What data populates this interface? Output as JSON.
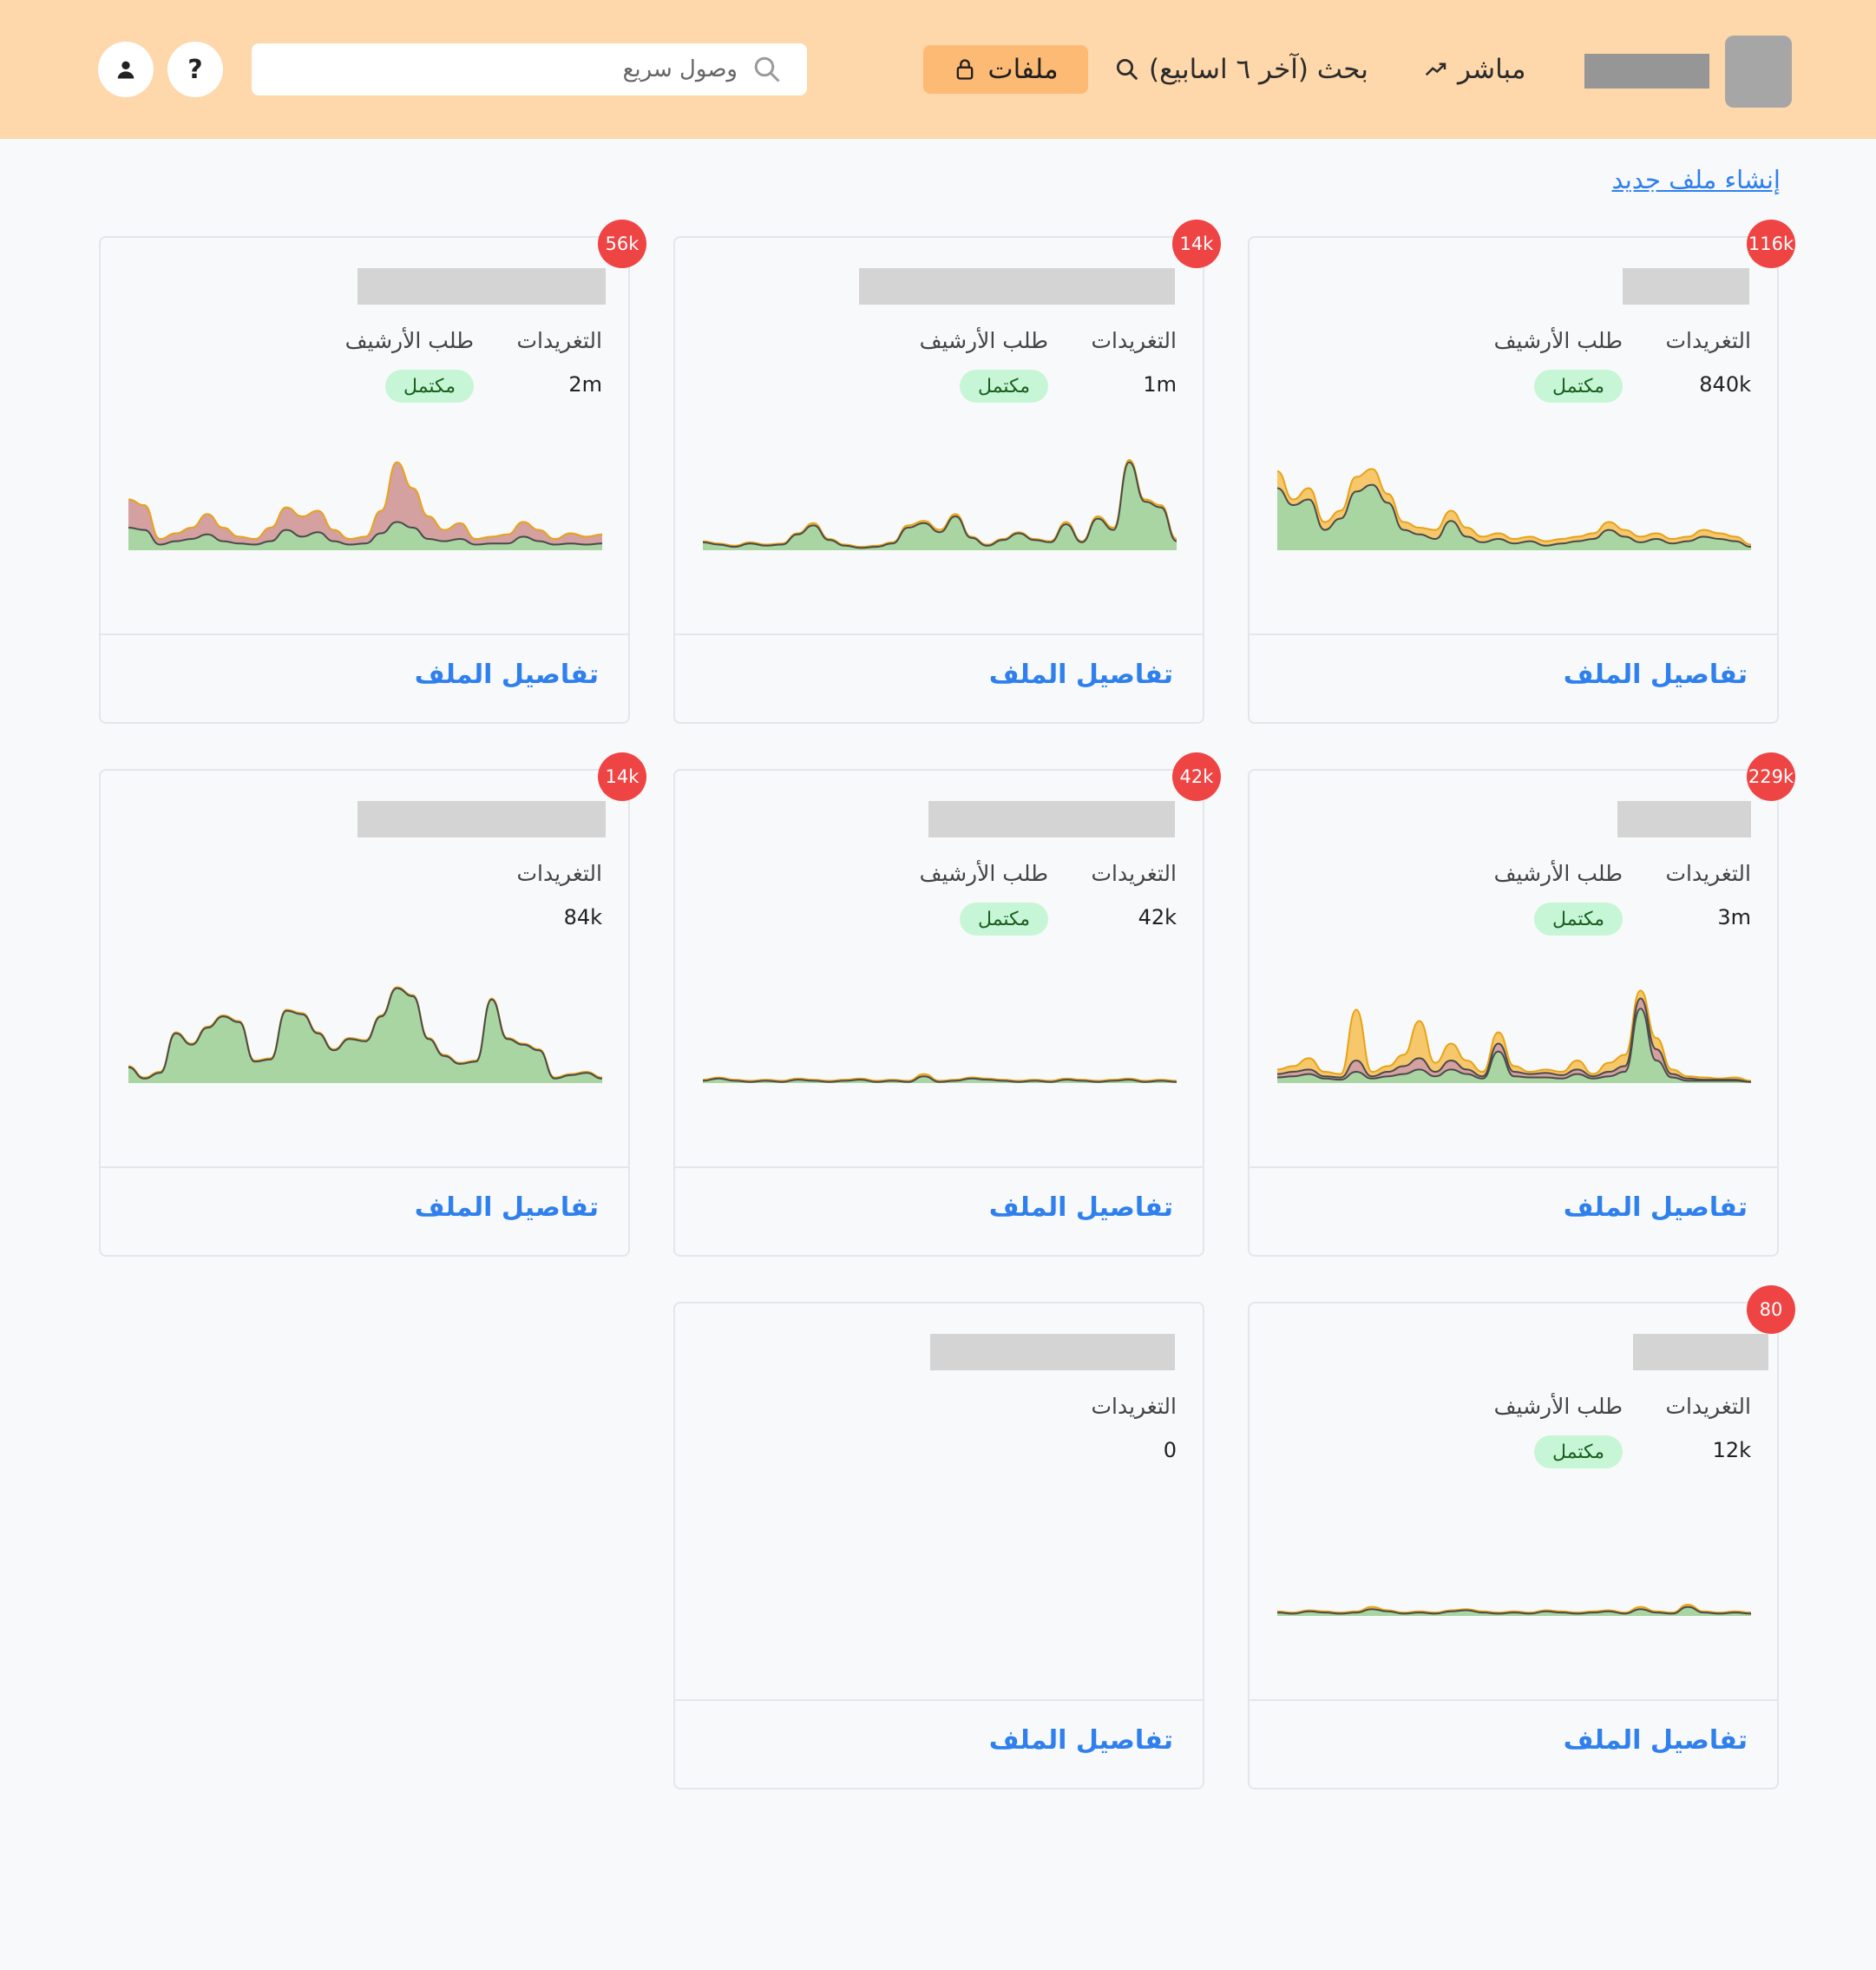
{
  "header": {
    "nav": {
      "live_label": "مباشر",
      "search_label": "بحث (آخر ٦ اسابيع)",
      "files_label": "ملفات"
    },
    "quick_access": {
      "placeholder": "وصول سريع",
      "value": ""
    },
    "help_label": "?",
    "icons": [
      "trend-up-icon",
      "search-icon",
      "lock-icon",
      "user-icon"
    ]
  },
  "main": {
    "create_link": "إنشاء ملف جديد",
    "labels": {
      "tweets": "التغريدات",
      "archive": "طلب الأرشيف",
      "complete": "مكتمل",
      "details": "تفاصيل الملف"
    },
    "colors": {
      "area_green": "#a8d5a2",
      "area_red": "#d4a0a0",
      "area_yellow": "#f6c76b",
      "badge": "#ef4444",
      "link": "#2f80ed"
    },
    "cards": [
      {
        "badge": "116k",
        "tweets": "840k",
        "archive_status": "مكتمل",
        "chart_data": {
          "type": "area",
          "series": [
            {
              "color": "#f6c76b",
              "values": [
                0.7,
                0.45,
                0.55,
                0.25,
                0.35,
                0.65,
                0.72,
                0.5,
                0.25,
                0.2,
                0.18,
                0.35,
                0.2,
                0.12,
                0.15,
                0.1,
                0.12,
                0.08,
                0.1,
                0.12,
                0.15,
                0.25,
                0.18,
                0.12,
                0.15,
                0.1,
                0.12,
                0.18,
                0.15,
                0.12,
                0.05
              ]
            },
            {
              "color": "#a8d5a2",
              "values": [
                0.55,
                0.4,
                0.45,
                0.18,
                0.28,
                0.52,
                0.58,
                0.42,
                0.18,
                0.14,
                0.1,
                0.26,
                0.12,
                0.07,
                0.1,
                0.06,
                0.08,
                0.04,
                0.06,
                0.08,
                0.1,
                0.18,
                0.12,
                0.07,
                0.1,
                0.06,
                0.08,
                0.12,
                0.1,
                0.08,
                0.03
              ]
            }
          ]
        }
      },
      {
        "badge": "14k",
        "tweets": "1m",
        "archive_status": "مكتمل",
        "chart_data": {
          "type": "area",
          "series": [
            {
              "color": "#f6c76b",
              "values": [
                0.08,
                0.06,
                0.04,
                0.07,
                0.05,
                0.06,
                0.15,
                0.24,
                0.1,
                0.05,
                0.03,
                0.04,
                0.07,
                0.22,
                0.26,
                0.18,
                0.32,
                0.12,
                0.05,
                0.1,
                0.16,
                0.1,
                0.08,
                0.25,
                0.08,
                0.3,
                0.2,
                0.8,
                0.45,
                0.4,
                0.1
              ]
            },
            {
              "color": "#a8d5a2",
              "values": [
                0.07,
                0.05,
                0.03,
                0.06,
                0.04,
                0.05,
                0.14,
                0.22,
                0.09,
                0.04,
                0.02,
                0.03,
                0.06,
                0.2,
                0.24,
                0.16,
                0.3,
                0.11,
                0.04,
                0.09,
                0.15,
                0.09,
                0.07,
                0.23,
                0.07,
                0.28,
                0.18,
                0.78,
                0.43,
                0.38,
                0.08
              ]
            }
          ]
        }
      },
      {
        "badge": "56k",
        "tweets": "2m",
        "archive_status": "مكتمل",
        "chart_data": {
          "type": "area",
          "series": [
            {
              "color": "#d4a0a0",
              "values": [
                0.45,
                0.4,
                0.1,
                0.15,
                0.2,
                0.32,
                0.2,
                0.12,
                0.1,
                0.2,
                0.38,
                0.3,
                0.35,
                0.18,
                0.1,
                0.12,
                0.35,
                0.78,
                0.55,
                0.3,
                0.18,
                0.24,
                0.1,
                0.12,
                0.14,
                0.25,
                0.18,
                0.1,
                0.15,
                0.12,
                0.14
              ]
            },
            {
              "color": "#a8d5a2",
              "values": [
                0.2,
                0.18,
                0.05,
                0.08,
                0.1,
                0.14,
                0.08,
                0.06,
                0.05,
                0.08,
                0.18,
                0.12,
                0.16,
                0.08,
                0.05,
                0.06,
                0.15,
                0.25,
                0.2,
                0.1,
                0.08,
                0.1,
                0.05,
                0.06,
                0.06,
                0.12,
                0.08,
                0.05,
                0.06,
                0.05,
                0.06
              ]
            }
          ]
        }
      },
      {
        "badge": "229k",
        "tweets": "3m",
        "archive_status": "مكتمل",
        "chart_data": {
          "type": "area",
          "series": [
            {
              "color": "#f6c76b",
              "values": [
                0.12,
                0.15,
                0.22,
                0.1,
                0.08,
                0.65,
                0.1,
                0.15,
                0.25,
                0.55,
                0.18,
                0.35,
                0.2,
                0.1,
                0.45,
                0.15,
                0.1,
                0.12,
                0.1,
                0.2,
                0.08,
                0.18,
                0.25,
                0.82,
                0.4,
                0.12,
                0.06,
                0.05,
                0.04,
                0.05,
                0.02
              ]
            },
            {
              "color": "#d4a0a0",
              "values": [
                0.08,
                0.1,
                0.12,
                0.06,
                0.05,
                0.2,
                0.06,
                0.1,
                0.15,
                0.22,
                0.1,
                0.2,
                0.12,
                0.06,
                0.35,
                0.1,
                0.08,
                0.09,
                0.07,
                0.12,
                0.06,
                0.1,
                0.15,
                0.75,
                0.3,
                0.08,
                0.04,
                0.03,
                0.03,
                0.03,
                0.01
              ]
            },
            {
              "color": "#a8d5a2",
              "values": [
                0.05,
                0.06,
                0.08,
                0.04,
                0.03,
                0.1,
                0.04,
                0.06,
                0.08,
                0.12,
                0.06,
                0.12,
                0.08,
                0.04,
                0.28,
                0.06,
                0.05,
                0.05,
                0.04,
                0.08,
                0.04,
                0.06,
                0.1,
                0.66,
                0.2,
                0.05,
                0.02,
                0.02,
                0.02,
                0.02,
                0.01
              ]
            }
          ]
        }
      },
      {
        "badge": "42k",
        "tweets": "42k",
        "archive_status": "مكتمل",
        "chart_data": {
          "type": "area",
          "series": [
            {
              "color": "#f6c76b",
              "values": [
                0.03,
                0.05,
                0.03,
                0.02,
                0.03,
                0.02,
                0.04,
                0.03,
                0.02,
                0.03,
                0.04,
                0.02,
                0.03,
                0.02,
                0.08,
                0.02,
                0.03,
                0.05,
                0.04,
                0.03,
                0.02,
                0.03,
                0.02,
                0.04,
                0.03,
                0.02,
                0.03,
                0.04,
                0.02,
                0.03,
                0.02
              ]
            },
            {
              "color": "#a8d5a2",
              "values": [
                0.02,
                0.04,
                0.02,
                0.01,
                0.02,
                0.01,
                0.03,
                0.02,
                0.01,
                0.02,
                0.03,
                0.01,
                0.02,
                0.01,
                0.06,
                0.01,
                0.02,
                0.04,
                0.03,
                0.02,
                0.01,
                0.02,
                0.01,
                0.03,
                0.02,
                0.01,
                0.02,
                0.03,
                0.01,
                0.02,
                0.01
              ]
            }
          ]
        }
      },
      {
        "badge": "14k",
        "tweets": "84k",
        "chart_data": {
          "type": "area",
          "series": [
            {
              "color": "#f6c76b",
              "values": [
                0.15,
                0.05,
                0.1,
                0.45,
                0.35,
                0.5,
                0.6,
                0.55,
                0.2,
                0.22,
                0.65,
                0.62,
                0.45,
                0.3,
                0.4,
                0.38,
                0.6,
                0.85,
                0.78,
                0.4,
                0.25,
                0.18,
                0.2,
                0.75,
                0.4,
                0.35,
                0.3,
                0.05,
                0.08,
                0.1,
                0.05
              ]
            },
            {
              "color": "#a8d5a2",
              "values": [
                0.14,
                0.04,
                0.09,
                0.44,
                0.34,
                0.49,
                0.59,
                0.54,
                0.19,
                0.21,
                0.64,
                0.61,
                0.44,
                0.29,
                0.39,
                0.37,
                0.59,
                0.84,
                0.77,
                0.39,
                0.24,
                0.17,
                0.19,
                0.74,
                0.39,
                0.34,
                0.29,
                0.04,
                0.07,
                0.09,
                0.04
              ]
            }
          ]
        }
      },
      {
        "badge": "80",
        "tweets": "12k",
        "archive_status": "مكتمل",
        "chart_data": {
          "type": "area",
          "series": [
            {
              "color": "#f6c76b",
              "values": [
                0.04,
                0.03,
                0.05,
                0.04,
                0.03,
                0.04,
                0.08,
                0.05,
                0.03,
                0.04,
                0.03,
                0.05,
                0.06,
                0.04,
                0.03,
                0.04,
                0.03,
                0.05,
                0.04,
                0.03,
                0.04,
                0.05,
                0.03,
                0.08,
                0.04,
                0.03,
                0.1,
                0.04,
                0.03,
                0.04,
                0.03
              ]
            },
            {
              "color": "#a8d5a2",
              "values": [
                0.03,
                0.02,
                0.04,
                0.03,
                0.02,
                0.03,
                0.06,
                0.04,
                0.02,
                0.03,
                0.02,
                0.04,
                0.05,
                0.03,
                0.02,
                0.03,
                0.02,
                0.04,
                0.03,
                0.02,
                0.03,
                0.04,
                0.02,
                0.06,
                0.03,
                0.02,
                0.08,
                0.03,
                0.02,
                0.03,
                0.02
              ]
            }
          ]
        }
      },
      {
        "tweets": "0"
      }
    ]
  }
}
